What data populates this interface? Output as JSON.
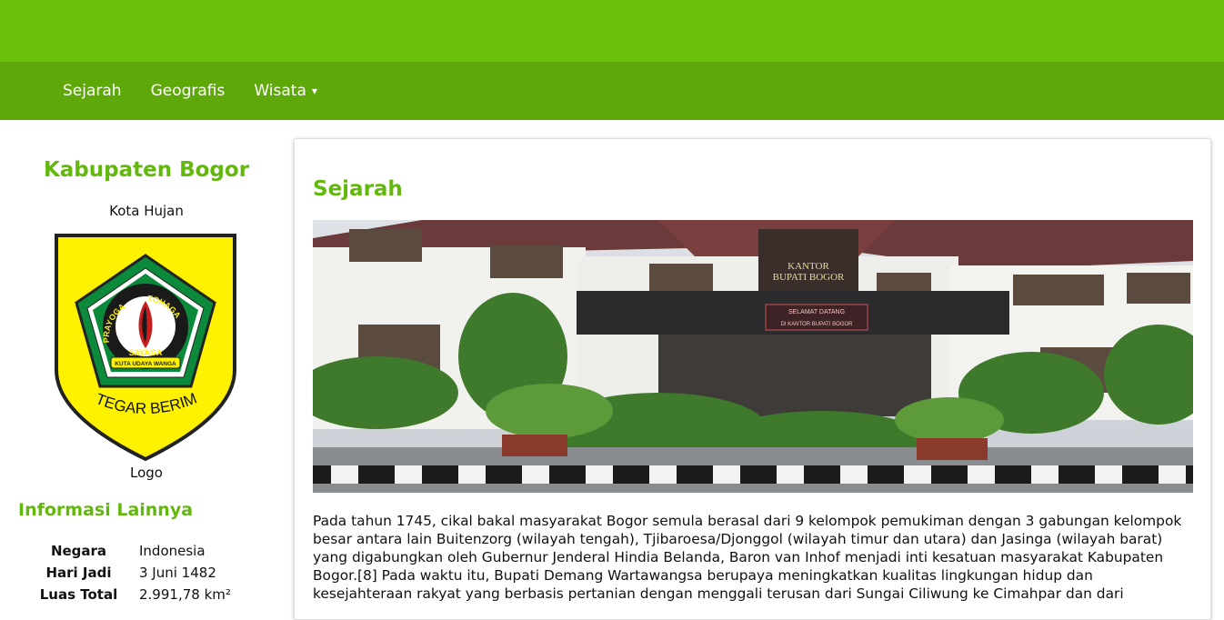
{
  "nav": {
    "items": [
      {
        "label": "Sejarah"
      },
      {
        "label": "Geografis"
      },
      {
        "label": "Wisata"
      }
    ],
    "dropdown_caret": "▾"
  },
  "sidebar": {
    "title": "Kabupaten Bogor",
    "subtitle": "Kota Hujan",
    "logo_caption": "Logo",
    "logo_text": {
      "left_arc": "PRAYOGA",
      "right_arc": "TOHAGA",
      "center": "SAYAGA",
      "ribbon": "KUTA UDAYA WANGA",
      "bottom": "TEGAR BERIMAN"
    },
    "info_title": "Informasi Lainnya",
    "info_rows": [
      {
        "key": "Negara",
        "value": "Indonesia"
      },
      {
        "key": "Hari Jadi",
        "value": "3 Juni 1482"
      },
      {
        "key": "Luas Total",
        "value": "2.991,78 km²"
      }
    ]
  },
  "main": {
    "section_title": "Sejarah",
    "photo_text": {
      "sign_line1": "KANTOR",
      "sign_line2": "BUPATI BOGOR",
      "banner_line1": "SELAMAT DATANG",
      "banner_line2": "DI KANTOR BUPATI BOGOR"
    },
    "paragraph": "Pada tahun 1745, cikal bakal masyarakat Bogor semula berasal dari 9 kelompok pemukiman dengan 3 gabungan kelompok besar antara lain Buitenzorg (wilayah tengah), Tjibaroesa/Djonggol (wilayah timur dan utara) dan Jasinga (wilayah barat) yang digabungkan oleh Gubernur Jenderal Hindia Belanda, Baron van Inhof menjadi inti kesatuan masyarakat Kabupaten Bogor.[8] Pada waktu itu, Bupati Demang Wartawangsa berupaya meningkatkan kualitas lingkungan hidup dan kesejahteraan rakyat yang berbasis pertanian dengan menggali terusan dari Sungai Ciliwung ke Cimahpar dan dari"
  },
  "colors": {
    "topbar": "#6cc20a",
    "navbar": "#5ea80a",
    "accent_text": "#62b80c",
    "shield_yellow": "#fff200",
    "shield_green": "#0a8a3a"
  }
}
